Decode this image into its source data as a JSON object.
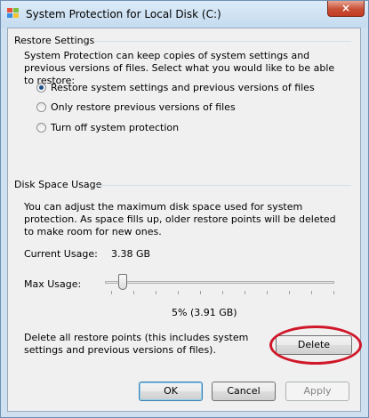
{
  "window": {
    "title": "System Protection for Local Disk (C:)",
    "close_label": "×"
  },
  "restore_settings": {
    "group_title": "Restore Settings",
    "description": "System Protection can keep copies of system settings and previous versions of files. Select what you would like to be able to restore:",
    "options": [
      {
        "label": "Restore system settings and previous versions of files",
        "checked": true
      },
      {
        "label": "Only restore previous versions of files",
        "checked": false
      },
      {
        "label": "Turn off system protection",
        "checked": false
      }
    ]
  },
  "disk_space": {
    "group_title": "Disk Space Usage",
    "description": "You can adjust the maximum disk space used for system protection. As space fills up, older restore points will be deleted to make room for new ones.",
    "current_usage_label": "Current Usage:",
    "current_usage_value": "3.38 GB",
    "max_usage_label": "Max Usage:",
    "max_usage_percent": 5,
    "max_usage_readout": "5% (3.91 GB)",
    "delete_description": "Delete all restore points (this includes system settings and previous versions of files).",
    "delete_label": "Delete"
  },
  "footer": {
    "ok_label": "OK",
    "cancel_label": "Cancel",
    "apply_label": "Apply"
  },
  "colors": {
    "annotation": "#d0182a",
    "title_bar": "#c4dbef"
  }
}
